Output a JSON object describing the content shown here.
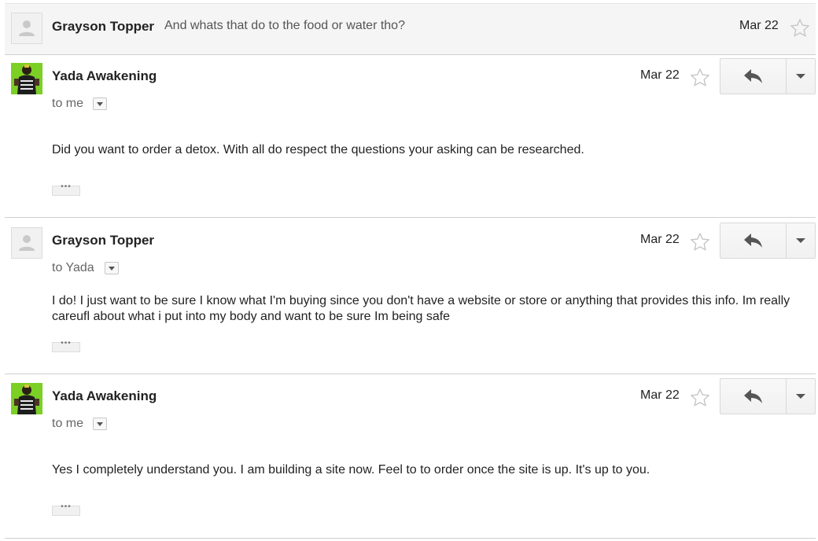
{
  "thread": {
    "collapsed_message": {
      "sender": "Grayson Topper",
      "snippet": "And whats that do to the food or water tho?",
      "date": "Mar 22"
    },
    "messages": [
      {
        "sender": "Yada Awakening",
        "date": "Mar 22",
        "recipient": "to me",
        "body": "Did you want to order a detox.  With all do respect the questions your asking can be researched."
      },
      {
        "sender": "Grayson Topper",
        "date": "Mar 22",
        "recipient": "to Yada",
        "body": "I do! I just want to be sure I know what I'm buying since you don't have a website or store or anything that provides this info. Im really careufl about what i put into my body and want to be sure Im being safe"
      },
      {
        "sender": "Yada Awakening",
        "date": "Mar 22",
        "recipient": "to me",
        "body": "Yes I completely understand you.  I am building a site now.  Feel to to order once the site is up.  It's up to you."
      }
    ]
  },
  "icons": {
    "star": "star-outline-icon",
    "reply": "reply-arrow-icon",
    "more": "chevron-down-icon",
    "generic_avatar": "person-silhouette-icon"
  },
  "colors": {
    "collapsed_bg": "#f5f5f5",
    "star_outline": "#c6c6c6",
    "yada_avatar_bg": "#7ccf24"
  }
}
